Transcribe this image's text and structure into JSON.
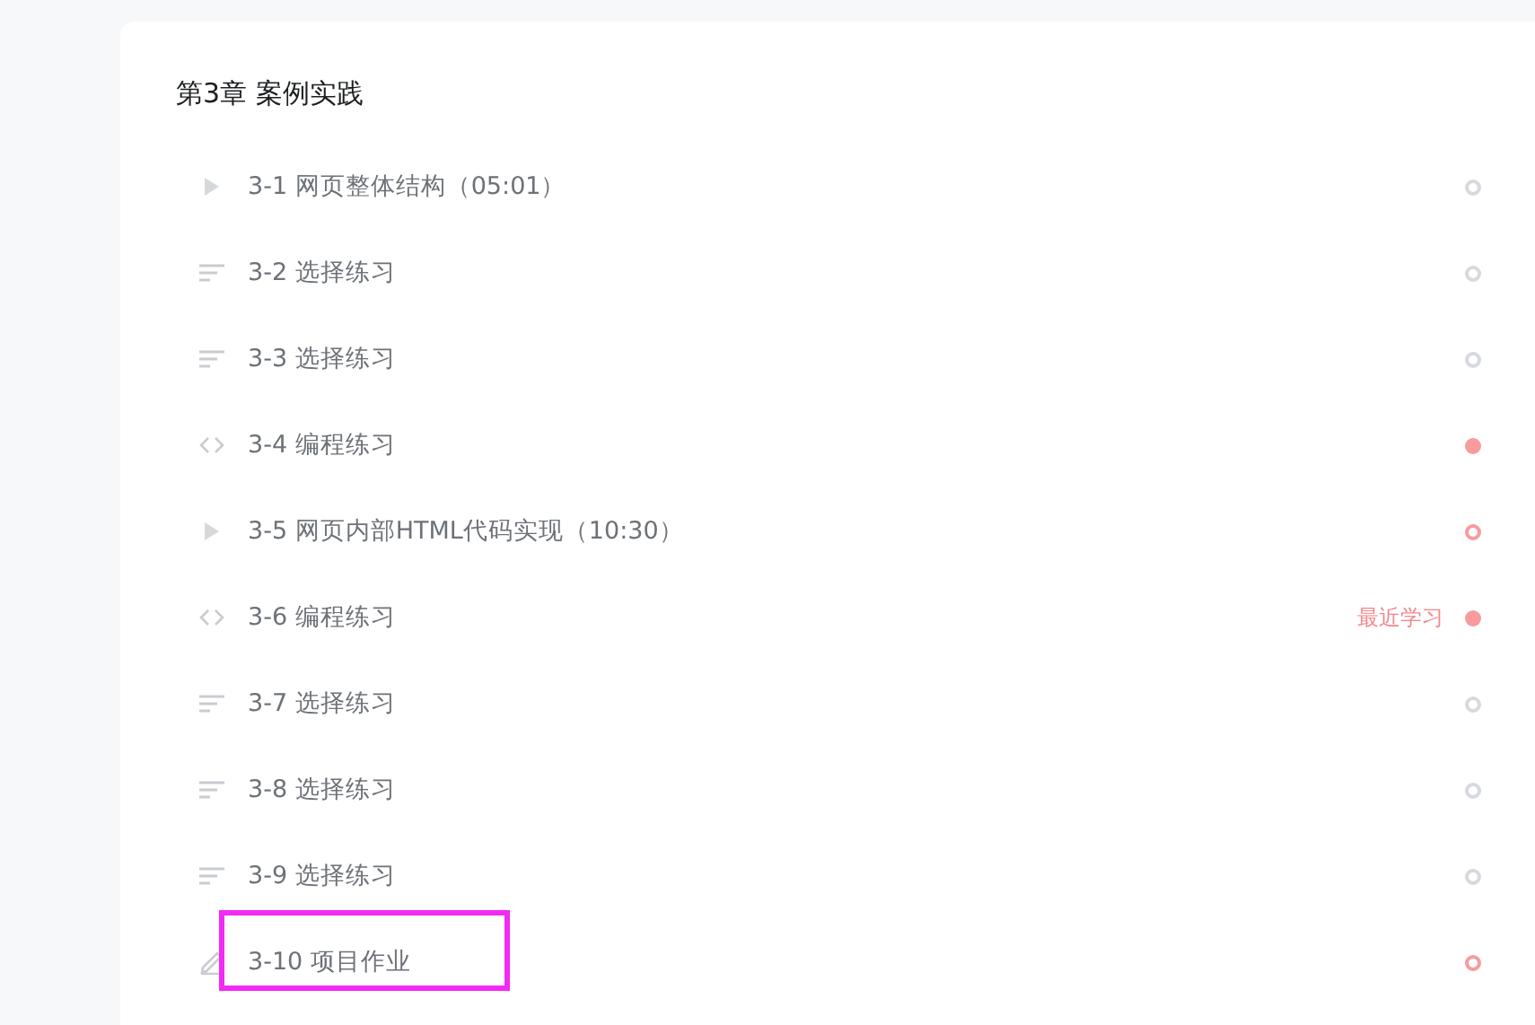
{
  "chapter": {
    "title": "第3章 案例实践"
  },
  "lessons": [
    {
      "kind": "video",
      "label": "3-1 网页整体结构（05:01）",
      "started": false,
      "done": false,
      "highlighted": false
    },
    {
      "kind": "quiz",
      "label": "3-2 选择练习",
      "started": false,
      "done": false,
      "highlighted": false
    },
    {
      "kind": "quiz",
      "label": "3-3 选择练习",
      "started": false,
      "done": false,
      "highlighted": false
    },
    {
      "kind": "code",
      "label": "3-4 编程练习",
      "started": true,
      "done": true,
      "highlighted": false
    },
    {
      "kind": "video",
      "label": "3-5 网页内部HTML代码实现（10:30）",
      "started": true,
      "done": false,
      "highlighted": false
    },
    {
      "kind": "code",
      "label": "3-6 编程练习",
      "started": true,
      "done": true,
      "badge": "最近学习",
      "highlighted": false
    },
    {
      "kind": "quiz",
      "label": "3-7 选择练习",
      "started": false,
      "done": false,
      "highlighted": false
    },
    {
      "kind": "quiz",
      "label": "3-8 选择练习",
      "started": false,
      "done": false,
      "highlighted": false
    },
    {
      "kind": "quiz",
      "label": "3-9 选择练习",
      "started": false,
      "done": false,
      "highlighted": false
    },
    {
      "kind": "project",
      "label": "3-10 项目作业",
      "started": true,
      "done": false,
      "highlighted": true
    }
  ]
}
